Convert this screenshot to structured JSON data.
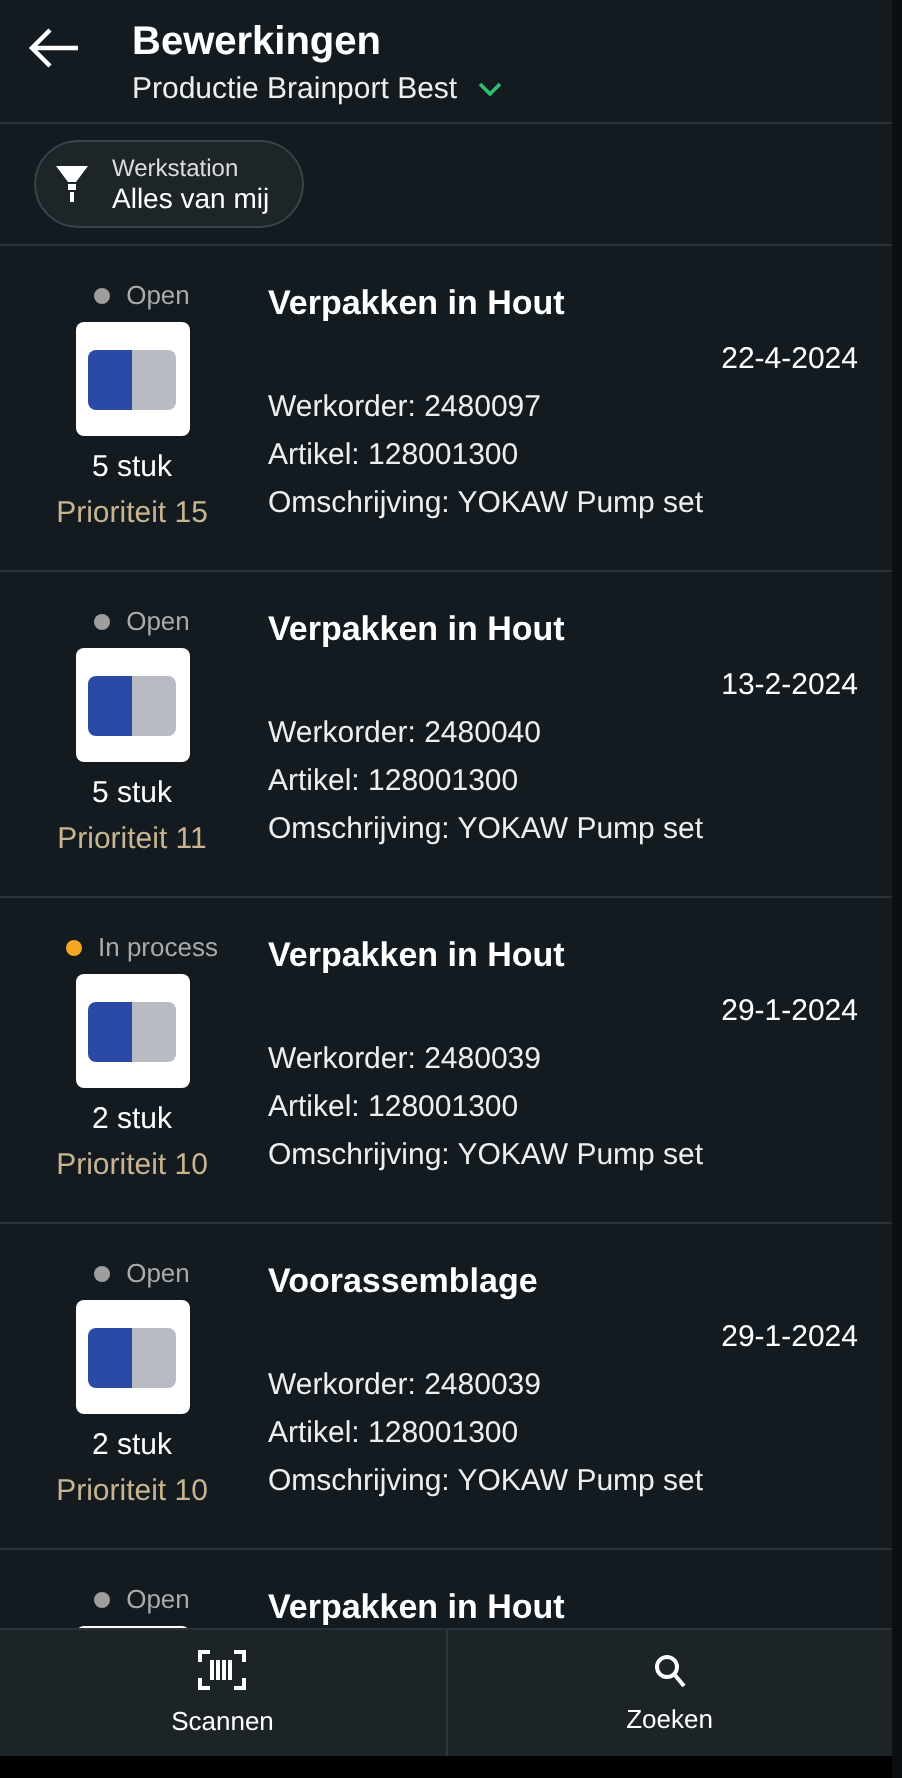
{
  "header": {
    "title": "Bewerkingen",
    "subtitle": "Productie Brainport Best"
  },
  "filter": {
    "label": "Werkstation",
    "value": "Alles van mij"
  },
  "orders": [
    {
      "status": "Open",
      "color": "#9e9e9e",
      "quantity": "5 stuk",
      "priority": "Prioriteit 15",
      "title": "Verpakken in Hout",
      "date": "22-4-2024",
      "workorder": "Werkorder: 2480097",
      "article": "Artikel: 128001300",
      "description": "Omschrijving: YOKAW Pump set"
    },
    {
      "status": "Open",
      "color": "#9e9e9e",
      "quantity": "5 stuk",
      "priority": "Prioriteit 11",
      "title": "Verpakken in Hout",
      "date": "13-2-2024",
      "workorder": "Werkorder: 2480040",
      "article": "Artikel: 128001300",
      "description": "Omschrijving: YOKAW Pump set"
    },
    {
      "status": "In process",
      "color": "#f5a623",
      "quantity": "2 stuk",
      "priority": "Prioriteit 10",
      "title": "Verpakken in Hout",
      "date": "29-1-2024",
      "workorder": "Werkorder: 2480039",
      "article": "Artikel: 128001300",
      "description": "Omschrijving: YOKAW Pump set"
    },
    {
      "status": "Open",
      "color": "#9e9e9e",
      "quantity": "2 stuk",
      "priority": "Prioriteit 10",
      "title": "Voorassemblage",
      "date": "29-1-2024",
      "workorder": "Werkorder: 2480039",
      "article": "Artikel: 128001300",
      "description": "Omschrijving: YOKAW Pump set"
    },
    {
      "status": "Open",
      "color": "#9e9e9e",
      "title": "Verpakken in Hout"
    }
  ],
  "bottom_nav": [
    {
      "kind": "scan",
      "label": "Scannen"
    },
    {
      "kind": "search",
      "label": "Zoeken"
    }
  ]
}
